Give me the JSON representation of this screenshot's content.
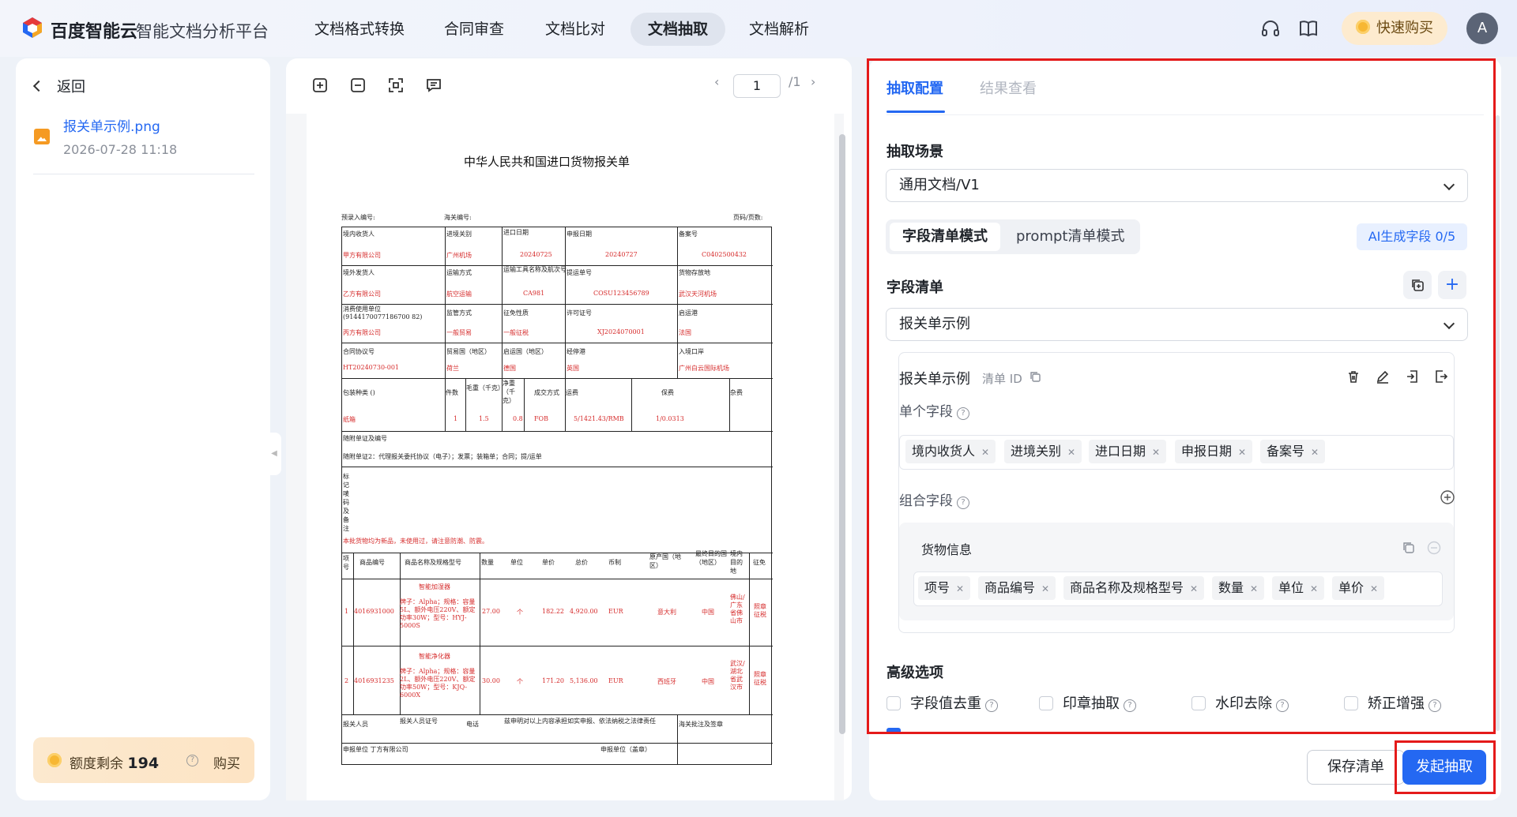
{
  "header": {
    "brand": "百度智能云",
    "platform": "智能文档分析平台",
    "nav": [
      "文档格式转换",
      "合同审查",
      "文档比对",
      "文档抽取",
      "文档解析"
    ],
    "active_nav": "文档抽取",
    "buy_label": "快速购买",
    "avatar_letter": "A"
  },
  "sidebar": {
    "back_label": "返回",
    "file_name": "报关单示例.png",
    "file_date": "2026-07-28 11:18",
    "quota_label": "额度剩余",
    "quota_value": "194",
    "quota_buy": "购买"
  },
  "viewer": {
    "page_current": "1",
    "page_total": "/1",
    "document": {
      "title": "中华人民共和国进口货物报关单",
      "pre_no": "预录入编号:",
      "customs_no": "海关编号:",
      "page_no": "页码/页数:",
      "rows": [
        {
          "cells": [
            {
              "label": "境内收货人",
              "value": "甲方有限公司"
            },
            {
              "label": "进境关别",
              "value": "广州机场"
            },
            {
              "label": "进口日期",
              "value": "20240725"
            },
            {
              "label": "申报日期",
              "value": "20240727"
            },
            {
              "label": "备案号",
              "value": "C0402500432"
            }
          ]
        },
        {
          "cells": [
            {
              "label": "境外发货人",
              "value": "乙方有限公司"
            },
            {
              "label": "运输方式",
              "value": "航空运输"
            },
            {
              "label": "运输工具名称及航次号",
              "value": "CA981"
            },
            {
              "label": "提运单号",
              "value": "COSU123456789"
            },
            {
              "label": "货物存放地",
              "value": "武汉天河机场"
            }
          ]
        },
        {
          "cells": [
            {
              "label": "消费使用单位(9144170077186700 82)",
              "value": "丙方有限公司"
            },
            {
              "label": "监管方式",
              "value": "一般贸易"
            },
            {
              "label": "征免性质",
              "value": "一般征税"
            },
            {
              "label": "许可证号",
              "value": "XJ2024070001"
            },
            {
              "label": "启运港",
              "value": "法国"
            }
          ]
        },
        {
          "cells": [
            {
              "label": "合同协议号",
              "value": "HT20240730-001"
            },
            {
              "label": "贸易国（地区）",
              "value": "荷兰"
            },
            {
              "label": "启运国（地区）",
              "value": "德国"
            },
            {
              "label": "经停港",
              "value": "英国"
            },
            {
              "label": "入境口岸",
              "value": "广州白云国际机场"
            }
          ]
        }
      ],
      "pack_row": {
        "labels": [
          "包装种类 ()",
          "件数",
          "毛重（千克）",
          "净重（千克）",
          "成交方式",
          "运费",
          "保费",
          "杂费"
        ],
        "values": [
          "纸箱",
          "1",
          "1.5",
          "0.8",
          "FOB",
          "5/1421.43/RMB",
          "1/0.0313",
          ""
        ]
      },
      "attach_label": "随附单证及编号",
      "attach_value": "随附单证2：代理报关委托协议（电子）；发票；装箱单；合同；提/运单",
      "remarks_label": "标记唛码及备注",
      "remarks_value": "本批货物均为新品，未使用过，请注意防潮、防震。",
      "goods_headers": [
        "项号",
        "商品编号",
        "商品名称及规格型号",
        "数量",
        "单位",
        "单价",
        "总价",
        "币制",
        "原产国（地区）",
        "最终目的国（地区）",
        "境内目的地",
        "征免"
      ],
      "goods": [
        {
          "no": "1",
          "code": "4016931000",
          "name": "智能加湿器",
          "spec": "牌子：Alpha；规格：容量5L、额外电压220V、额定功率30W；型号：HYJ-5000S",
          "qty": "27.00",
          "unit": "个",
          "price": "182.22",
          "total": "4,920.00",
          "cur": "EUR",
          "origin": "意大利",
          "dest": "中国",
          "place": "佛山/广东省佛山市",
          "tax": "照章征税"
        },
        {
          "no": "2",
          "code": "4016931235",
          "name": "智能净化器",
          "spec": "牌子：Alpha；规格：容量2L、额外电压220V、额定功率50W；型号：KJQ-6000X",
          "qty": "30.00",
          "unit": "个",
          "price": "171.20",
          "total": "5,136.00",
          "cur": "EUR",
          "origin": "西班牙",
          "dest": "中国",
          "place": "武汉/湖北省武汉市",
          "tax": "照章征税"
        }
      ],
      "declarant": "报关人员",
      "declarant_cert": "报关人员证号",
      "phone": "电话",
      "statement": "兹申明对以上内容承担如实申报、依法纳税之法律责任",
      "customs_note": "海关批注及签章",
      "unit_label": "申报单位 丁方有限公司",
      "unit_seal": "申报单位（盖章）"
    }
  },
  "config": {
    "tabs": [
      "抽取配置",
      "结果查看"
    ],
    "scene_label": "抽取场景",
    "scene_value": "通用文档/V1",
    "mode_on": "字段清单模式",
    "mode_off": "prompt清单模式",
    "ai_button": "AI生成字段 0/5",
    "field_list_label": "字段清单",
    "field_list_value": "报关单示例",
    "card_title": "报关单示例",
    "card_id": "清单 ID",
    "single_label": "单个字段",
    "single_fields": [
      "境内收货人",
      "进境关别",
      "进口日期",
      "申报日期",
      "备案号"
    ],
    "group_label": "组合字段",
    "group_title": "货物信息",
    "group_fields": [
      "项号",
      "商品编号",
      "商品名称及规格型号",
      "数量",
      "单位",
      "单价"
    ],
    "advanced_label": "高级选项",
    "advanced_options": [
      "字段值去重",
      "印章抽取",
      "水印去除",
      "矫正增强"
    ],
    "save_button": "保存清单",
    "start_button": "发起抽取"
  },
  "colors": {
    "accent": "#2468f2",
    "highlight_border": "#e41a1a",
    "value_red": "#d62c2c"
  }
}
